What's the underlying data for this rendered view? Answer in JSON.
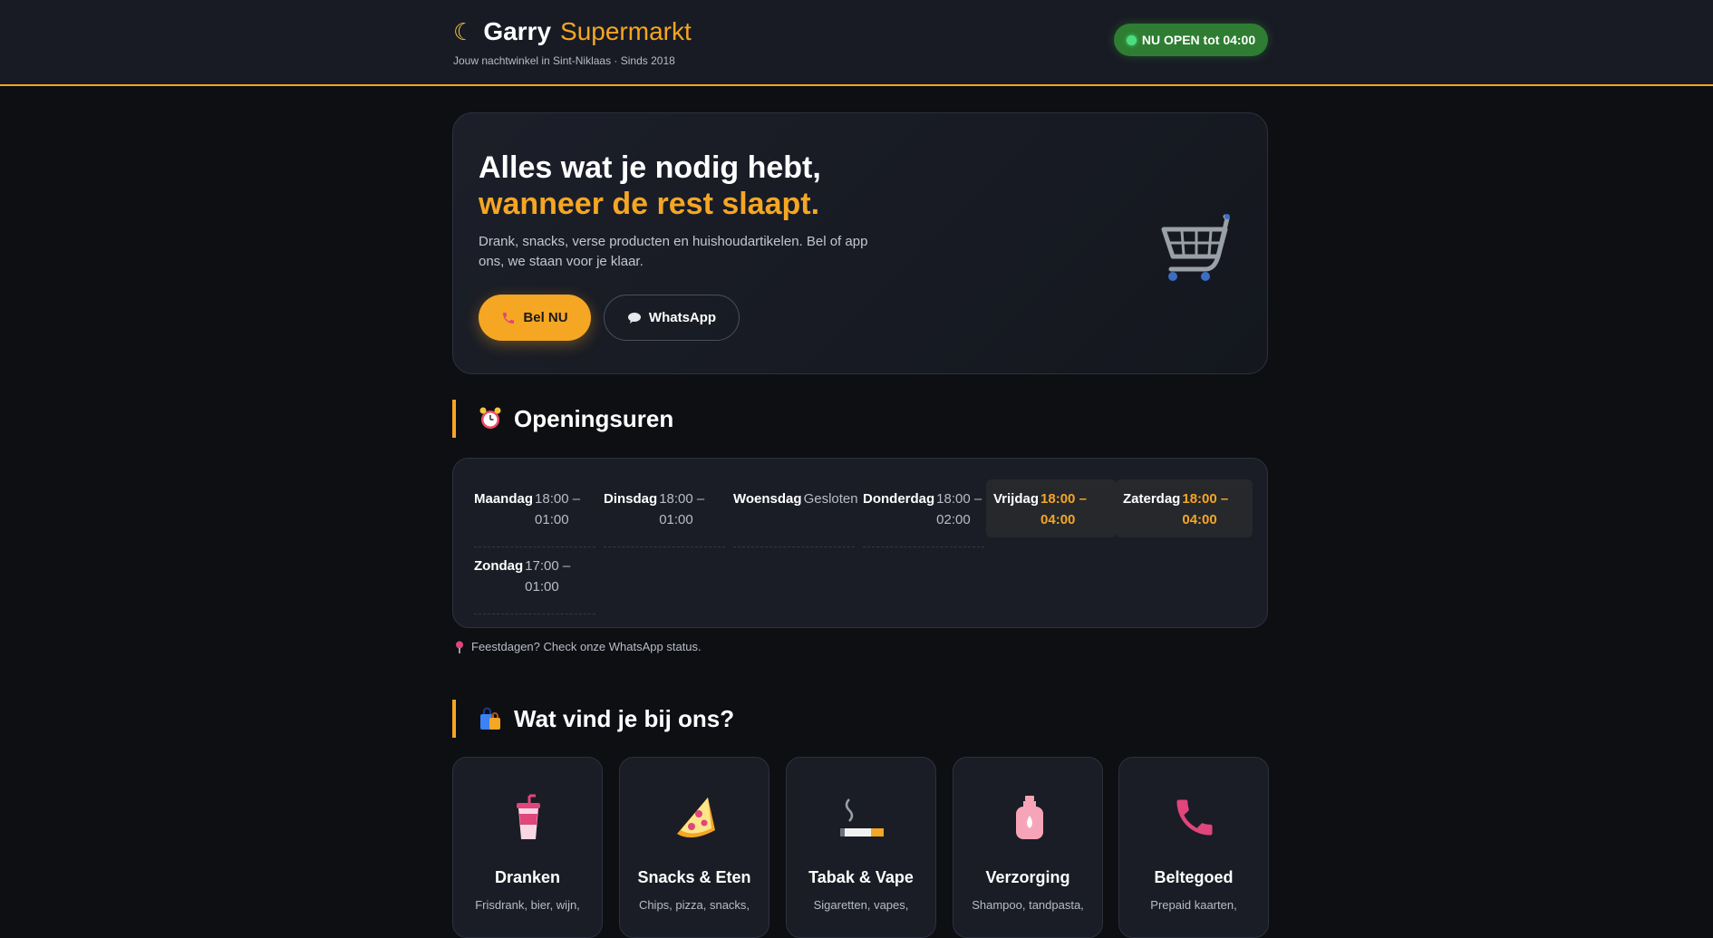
{
  "header": {
    "brand_name": "Garry",
    "brand_accent": "Supermarkt",
    "tagline": "Jouw nachtwinkel in Sint-Niklaas · Sinds 2018",
    "status_badge": "NU OPEN tot 04:00",
    "logo_icon": "moon-icon"
  },
  "hero": {
    "title_line1": "Alles wat je nodig hebt,",
    "title_line2": "wanneer de rest slaapt.",
    "description": "Drank, snacks, verse producten en huishoudartikelen. Bel of app ons, we staan voor je klaar.",
    "call_label": "Bel NU",
    "whatsapp_label": "WhatsApp",
    "illustration": "shopping-cart-icon"
  },
  "hours": {
    "title": "Openingsuren",
    "days": [
      {
        "name": "Maandag",
        "time": "18:00 – 01:00"
      },
      {
        "name": "Dinsdag",
        "time": "18:00 – 01:00"
      },
      {
        "name": "Woensdag",
        "time": "Gesloten"
      },
      {
        "name": "Donderdag",
        "time": "18:00 – 02:00"
      },
      {
        "name": "Vrijdag",
        "time": "18:00 – 04:00"
      },
      {
        "name": "Zaterdag",
        "time": "18:00 – 04:00"
      },
      {
        "name": "Zondag",
        "time": "17:00 – 01:00"
      }
    ],
    "note": "Feestdagen? Check onze WhatsApp status."
  },
  "products": {
    "title": "Wat vind je bij ons?",
    "categories": [
      {
        "name": "Dranken",
        "desc": "Frisdrank, bier, wijn,",
        "icon": "drink-cup-icon"
      },
      {
        "name": "Snacks & Eten",
        "desc": "Chips, pizza, snacks,",
        "icon": "pizza-icon"
      },
      {
        "name": "Tabak & Vape",
        "desc": "Sigaretten, vapes,",
        "icon": "cigarette-icon"
      },
      {
        "name": "Verzorging",
        "desc": "Shampoo, tandpasta,",
        "icon": "lotion-bottle-icon"
      },
      {
        "name": "Beltegoed",
        "desc": "Prepaid kaarten,",
        "icon": "phone-icon"
      }
    ]
  },
  "colors": {
    "accent": "#f5a623",
    "background": "#0d0f13",
    "card": "#1a1d25",
    "status_green": "#2e7d32"
  }
}
